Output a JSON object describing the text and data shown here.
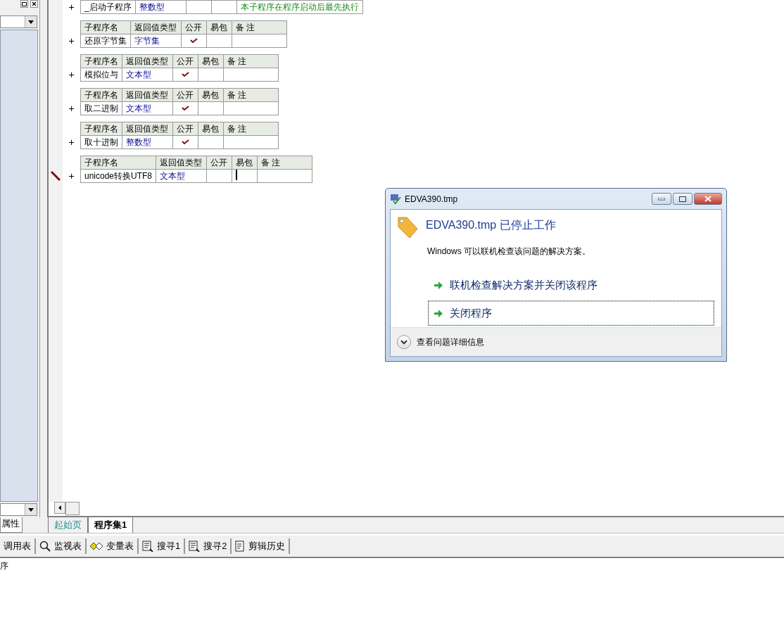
{
  "side_panel": {
    "tab": "属性"
  },
  "subroutines": [
    {
      "name": "_启动子程序",
      "return_type": "整数型",
      "public": false,
      "remark": "本子程序在程序启动后最先执行",
      "editing": false
    },
    {
      "columns": [
        "子程序名",
        "返回值类型",
        "公开",
        "易包",
        "备 注"
      ],
      "name": "还原字节集",
      "return_type": "字节集",
      "public": true,
      "editing": false
    },
    {
      "columns": [
        "子程序名",
        "返回值类型",
        "公开",
        "易包",
        "备 注"
      ],
      "name": "模拟位与",
      "return_type": "文本型",
      "public": true,
      "editing": false
    },
    {
      "columns": [
        "子程序名",
        "返回值类型",
        "公开",
        "易包",
        "备 注"
      ],
      "name": "取二进制",
      "return_type": "文本型",
      "public": true,
      "editing": false
    },
    {
      "columns": [
        "子程序名",
        "返回值类型",
        "公开",
        "易包",
        "备 注"
      ],
      "name": "取十进制",
      "return_type": "整数型",
      "public": true,
      "editing": false
    },
    {
      "columns": [
        "子程序名",
        "返回值类型",
        "公开",
        "易包",
        "备 注"
      ],
      "name": "unicode转换UTF8",
      "return_type": "文本型",
      "public": false,
      "editing": true
    }
  ],
  "plus_sign": "+",
  "doc_tabs": [
    {
      "label": "起始页",
      "selected": false
    },
    {
      "label": "程序集1",
      "selected": true
    }
  ],
  "tool_tabs": [
    {
      "label": "调用表",
      "kind": "plain"
    },
    {
      "label": "监视表",
      "kind": "watch"
    },
    {
      "label": "变量表",
      "kind": "vars"
    },
    {
      "label": "搜寻1",
      "kind": "search"
    },
    {
      "label": "搜寻2",
      "kind": "search"
    },
    {
      "label": "剪辑历史",
      "kind": "history"
    }
  ],
  "output": {
    "text": "序"
  },
  "dialog": {
    "title": "EDVA390.tmp",
    "heading": "EDVA390.tmp 已停止工作",
    "message": "Windows 可以联机检查该问题的解决方案。",
    "options": [
      {
        "label": "联机检查解决方案并关闭该程序",
        "focused": false
      },
      {
        "label": "关闭程序",
        "focused": true
      }
    ],
    "details": "查看问题详细信息"
  }
}
